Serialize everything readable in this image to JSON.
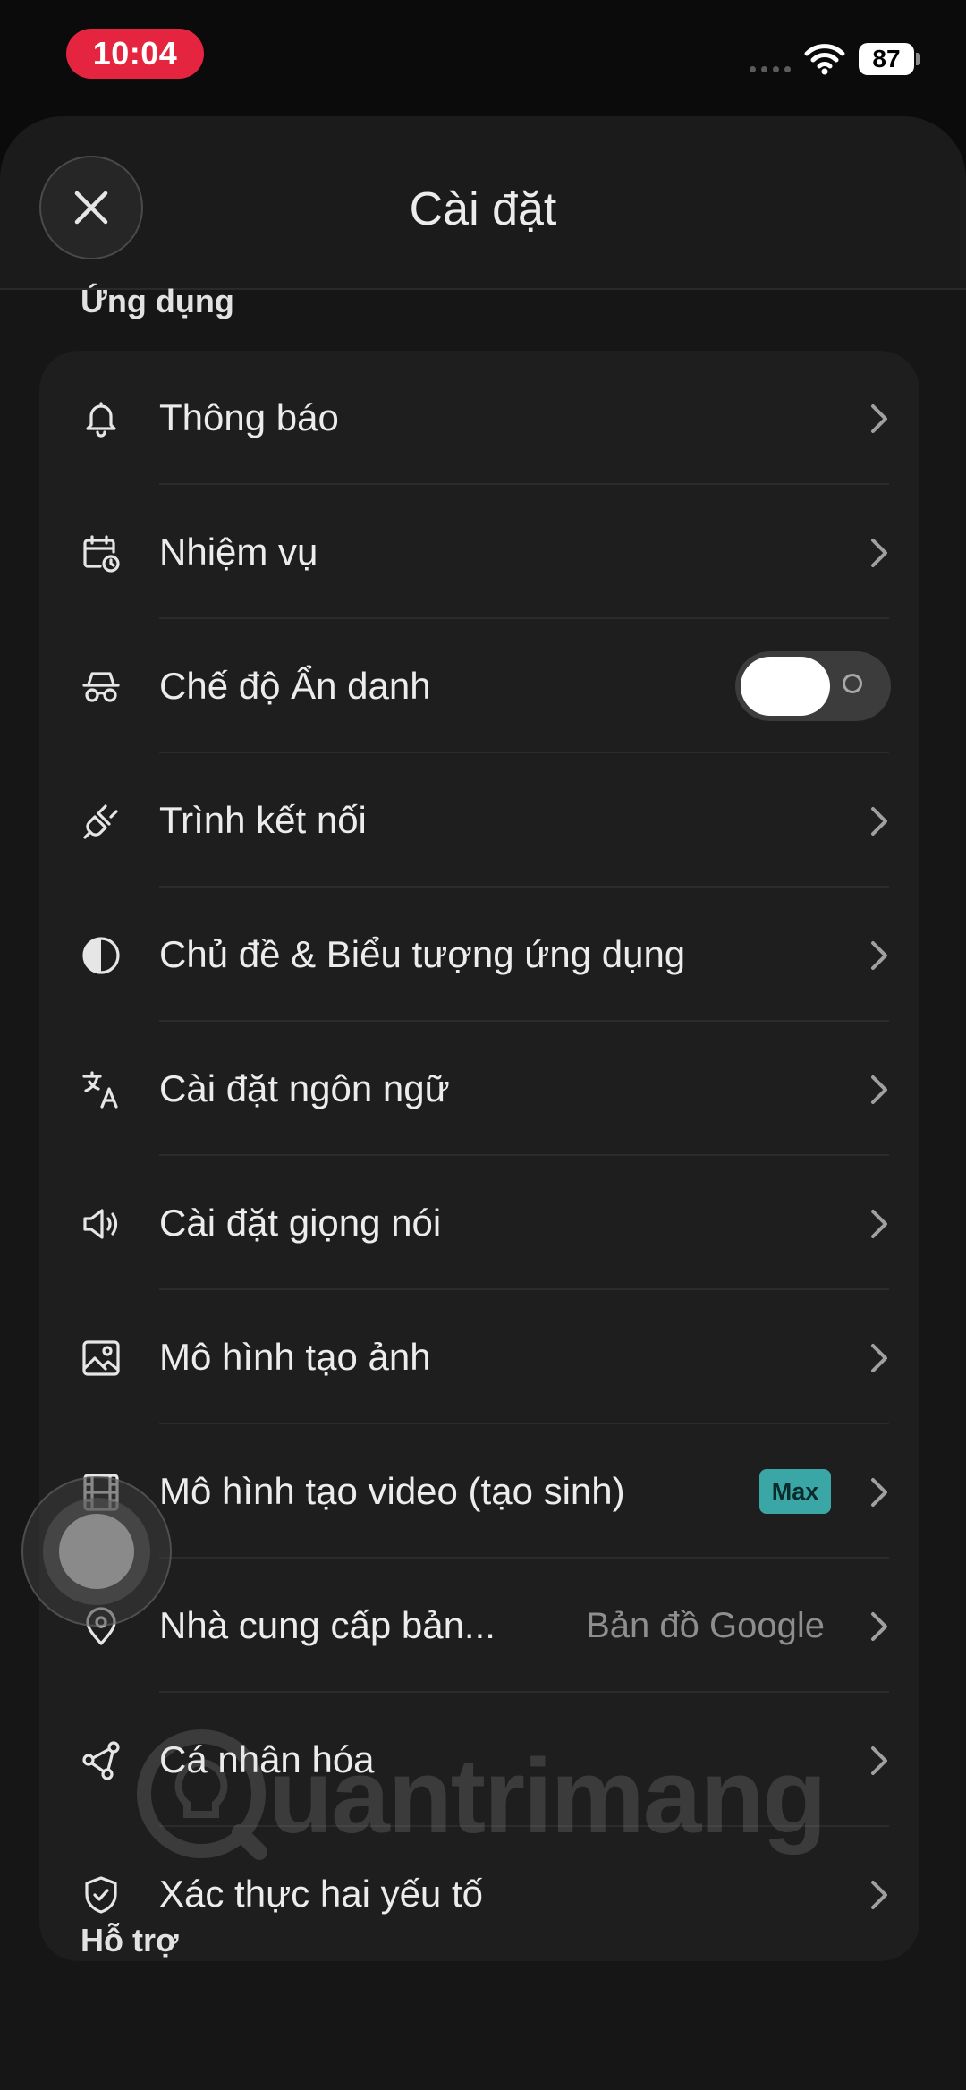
{
  "status_bar": {
    "time": "10:04",
    "battery": "87"
  },
  "header": {
    "title": "Cài đặt"
  },
  "sections": {
    "app": "Ứng dụng",
    "support": "Hỗ trợ"
  },
  "rows": [
    {
      "label": "Thông báo",
      "icon": "bell-icon"
    },
    {
      "label": "Nhiệm vụ",
      "icon": "calendar-clock-icon"
    },
    {
      "label": "Chế độ Ẩn danh",
      "icon": "incognito-icon",
      "toggle_on": false
    },
    {
      "label": "Trình kết nối",
      "icon": "plug-icon"
    },
    {
      "label": "Chủ đề & Biểu tượng ứng dụng",
      "icon": "half-circle-icon"
    },
    {
      "label": "Cài đặt ngôn ngữ",
      "icon": "translate-icon"
    },
    {
      "label": "Cài đặt giọng nói",
      "icon": "speaker-icon"
    },
    {
      "label": "Mô hình tạo ảnh",
      "icon": "image-icon"
    },
    {
      "label": "Mô hình tạo video (tạo sinh)",
      "icon": "film-icon",
      "badge": "Max"
    },
    {
      "label": "Nhà cung cấp bản...",
      "icon": "map-pin-icon",
      "value": "Bản đồ Google"
    },
    {
      "label": "Cá nhân hóa",
      "icon": "share-nodes-icon"
    },
    {
      "label": "Xác thực hai yếu tố",
      "icon": "shield-check-icon"
    }
  ],
  "watermark": "uantrimang",
  "colors": {
    "time_pill": "#e5243f",
    "badge": "#3aa6a6",
    "background": "#161616",
    "card": "#1e1e1e"
  }
}
